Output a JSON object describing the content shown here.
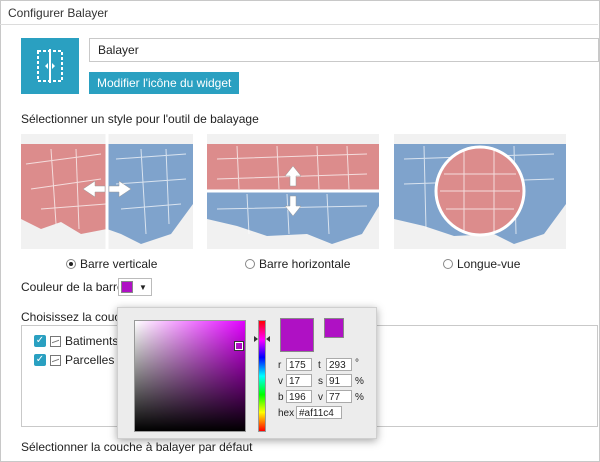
{
  "window": {
    "title": "Configurer Balayer"
  },
  "widget": {
    "name_value": "Balayer",
    "change_icon_label": "Modifier l'icône du widget"
  },
  "style_section": {
    "heading": "Sélectionner un style pour l'outil de balayage",
    "options": [
      {
        "label": "Barre verticale",
        "selected": true
      },
      {
        "label": "Barre horizontale",
        "selected": false
      },
      {
        "label": "Longue-vue",
        "selected": false
      }
    ]
  },
  "bar_color": {
    "label": "Couleur de la barre",
    "value": "#af11c4"
  },
  "layers_section": {
    "heading": "Choisissez la couche",
    "items": [
      {
        "label": "Batiments",
        "checked": true
      },
      {
        "label": "Parcelles",
        "checked": true
      }
    ]
  },
  "default_layer": {
    "heading": "Sélectionner la couche à balayer par défaut"
  },
  "color_picker": {
    "fields": {
      "r": {
        "label": "r",
        "value": "175"
      },
      "v1": {
        "label": "v",
        "value": "17"
      },
      "b": {
        "label": "b",
        "value": "196"
      },
      "t": {
        "label": "t",
        "value": "293",
        "unit": "°"
      },
      "s": {
        "label": "s",
        "value": "91",
        "unit": "%"
      },
      "v2": {
        "label": "v",
        "value": "77",
        "unit": "%"
      },
      "hex": {
        "label": "hex",
        "value": "#af11c4"
      }
    }
  },
  "colors": {
    "accent": "#2aa0c1",
    "selected_color": "#af11c4",
    "map_red": "#d46a6a",
    "map_blue": "#6f97c9"
  }
}
